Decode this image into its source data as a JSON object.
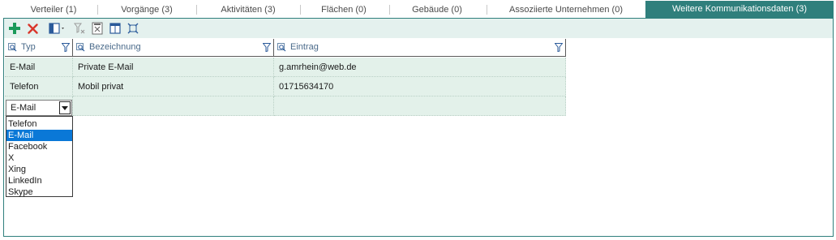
{
  "tabs": [
    {
      "label": "Verteiler (1)"
    },
    {
      "label": "Vorgänge (3)"
    },
    {
      "label": "Aktivitäten (3)"
    },
    {
      "label": "Flächen (0)"
    },
    {
      "label": "Gebäude (0)"
    },
    {
      "label": "Assoziierte Unternehmen (0)"
    },
    {
      "label": "Weitere Kommunikationsdaten (3)"
    }
  ],
  "active_tab": 6,
  "toolbar": {
    "icons": [
      "add-icon",
      "delete-icon",
      "column-chooser-icon",
      "clear-filter-icon",
      "export-icon",
      "layout-icon",
      "fit-columns-icon"
    ]
  },
  "grid": {
    "columns": [
      {
        "label": "Typ"
      },
      {
        "label": "Bezeichnung"
      },
      {
        "label": "Eintrag"
      }
    ],
    "rows": [
      {
        "typ": "E-Mail",
        "bezeichnung": "Private E-Mail",
        "eintrag": "g.amrhein@web.de"
      },
      {
        "typ": "Telefon",
        "bezeichnung": "Mobil privat",
        "eintrag": "01715634170"
      }
    ],
    "editor": {
      "value": "E-Mail",
      "options": [
        "Telefon",
        "E-Mail",
        "Facebook",
        "X",
        "Xing",
        "LinkedIn",
        "Skype"
      ],
      "selected_index": 1
    }
  },
  "colors": {
    "accent": "#2f7f7c",
    "toolbar_bg": "#e4f1ee",
    "row_bg": "#e3f1ea",
    "selection": "#0a78d7",
    "add_green": "#1a9a5a",
    "delete_red": "#d9362b"
  }
}
